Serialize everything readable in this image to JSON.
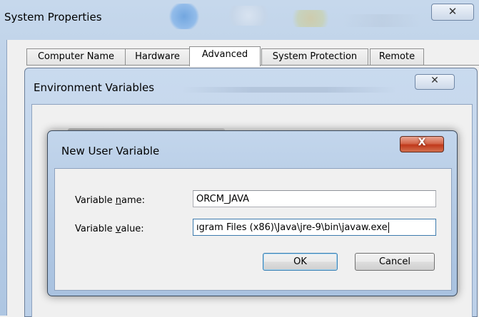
{
  "system_properties": {
    "title": "System Properties",
    "close_glyph": "✕",
    "tabs": [
      {
        "label": "Computer Name"
      },
      {
        "label": "Hardware"
      },
      {
        "label": "Advanced"
      },
      {
        "label": "System Protection"
      },
      {
        "label": "Remote"
      }
    ],
    "active_tab": "Advanced"
  },
  "environment_variables": {
    "title": "Environment Variables",
    "close_glyph": "✕"
  },
  "new_user_variable": {
    "title": "New User Variable",
    "close_glyph": "X",
    "name_label_pre": "Variable ",
    "name_label_key": "n",
    "name_label_post": "ame:",
    "value_label_pre": "Variable ",
    "value_label_key": "v",
    "value_label_post": "alue:",
    "name_value": "ORCM_JAVA",
    "value_value": "ıgram Files (x86)\\Java\\jre-9\\bin\\javaw.exe",
    "ok_label": "OK",
    "cancel_label": "Cancel"
  },
  "colors": {
    "aero_frame": "#b8cde6",
    "close_red": "#c0391b",
    "focus_blue": "#3d7bad"
  }
}
